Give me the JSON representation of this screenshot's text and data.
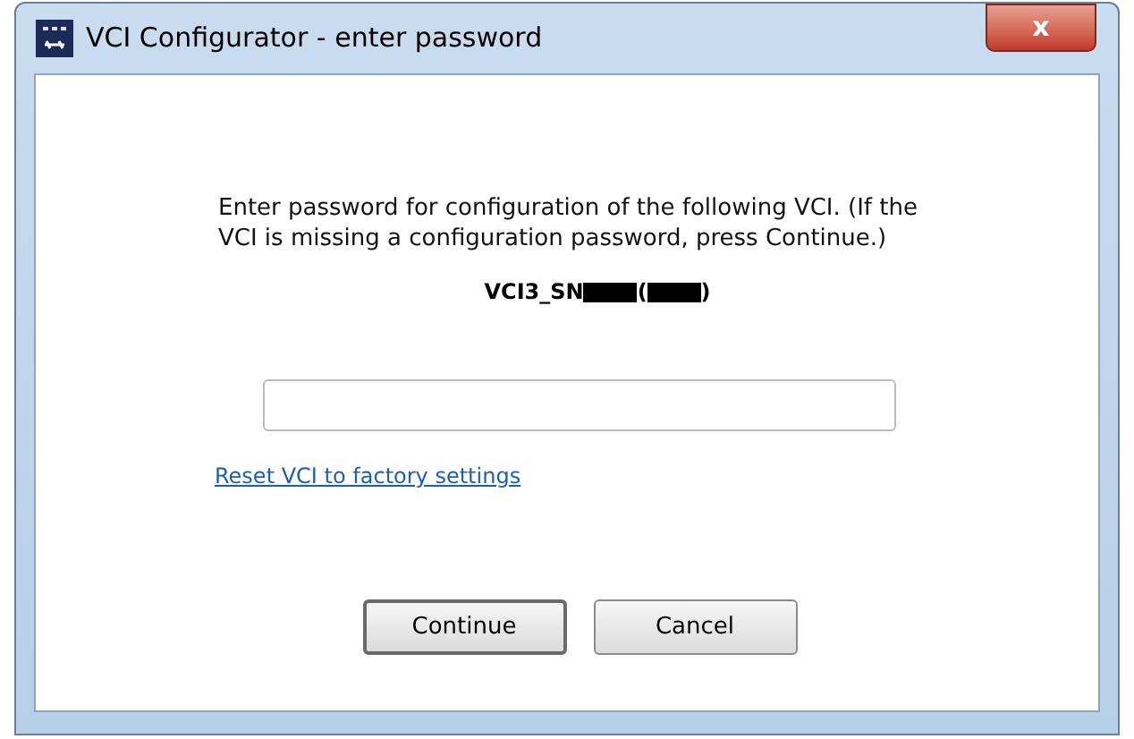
{
  "window": {
    "title": "VCI Configurator - enter password",
    "close_label": "x"
  },
  "message": "Enter password for configuration of the following VCI. (If the VCI is missing a configuration password, press Continue.)",
  "device": {
    "prefix": "VCI3_SN",
    "open": "(",
    "close": ")"
  },
  "link": "Reset VCI to factory settings",
  "buttons": [
    {
      "label": "Continue",
      "default": true
    },
    {
      "label": "Cancel",
      "default": false
    }
  ]
}
